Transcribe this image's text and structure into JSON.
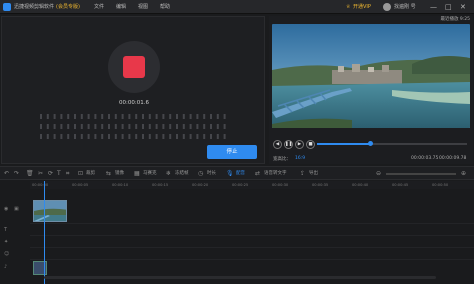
{
  "app": {
    "title": "迅捷视频剪辑软件",
    "edition": "(会员专版)"
  },
  "menu": [
    "文件",
    "编辑",
    "视图",
    "帮助"
  ],
  "header_right": {
    "vip_label": "开通VIP",
    "user_label": "找遍刚 号"
  },
  "window_controls": [
    "—",
    "□",
    "✕"
  ],
  "recorder": {
    "time": "00:00:01.6",
    "stop_label": "停止"
  },
  "preview": {
    "header": "最近播放 9:25",
    "ratio_label": "宽高比：",
    "ratio_value": "16:9",
    "time_left": "00:00:03.75",
    "time_right": "00:00:09.78",
    "progress": 0.35
  },
  "toolbar": {
    "tools": [
      "裁剪",
      "镜像",
      "马赛克",
      "冻结帧",
      "时长",
      "配音",
      "语音转文字",
      "导出"
    ]
  },
  "ruler": {
    "ticks": [
      "00:00:00",
      "00:00:05",
      "00:00:10",
      "00:00:15",
      "00:00:20",
      "00:00:25",
      "00:00:30",
      "00:00:35",
      "00:00:40",
      "00:00:45",
      "00:00:50"
    ]
  },
  "icons": {
    "logo": "app-logo-icon",
    "vip": "crown-icon",
    "user": "avatar-icon"
  },
  "colors": {
    "accent": "#2f8bf0",
    "record": "#e8384a",
    "vip": "#f0b830"
  }
}
